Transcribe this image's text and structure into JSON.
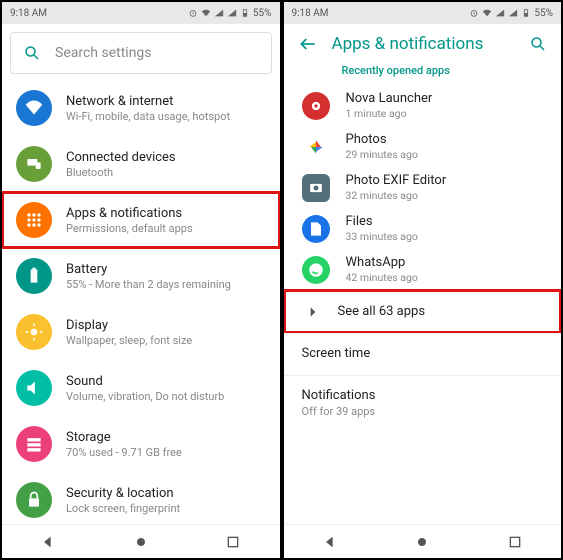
{
  "status": {
    "time": "9:18 AM",
    "battery": "55%"
  },
  "left": {
    "search_placeholder": "Search settings",
    "items": [
      {
        "title": "Network & internet",
        "sub": "Wi-Fi, mobile, data usage, hotspot"
      },
      {
        "title": "Connected devices",
        "sub": "Bluetooth"
      },
      {
        "title": "Apps & notifications",
        "sub": "Permissions, default apps"
      },
      {
        "title": "Battery",
        "sub": "55% - More than 2 days remaining"
      },
      {
        "title": "Display",
        "sub": "Wallpaper, sleep, font size"
      },
      {
        "title": "Sound",
        "sub": "Volume, vibration, Do not disturb"
      },
      {
        "title": "Storage",
        "sub": "70% used - 9.71 GB free"
      },
      {
        "title": "Security & location",
        "sub": "Lock screen, fingerprint"
      }
    ]
  },
  "right": {
    "header": "Apps & notifications",
    "subheader": "Recently opened apps",
    "apps": [
      {
        "title": "Nova Launcher",
        "sub": "1 minute ago"
      },
      {
        "title": "Photos",
        "sub": "29 minutes ago"
      },
      {
        "title": "Photo EXIF Editor",
        "sub": "32 minutes ago"
      },
      {
        "title": "Files",
        "sub": "33 minutes ago"
      },
      {
        "title": "WhatsApp",
        "sub": "42 minutes ago"
      }
    ],
    "see_all": "See all 63 apps",
    "screen_time": "Screen time",
    "notifications_title": "Notifications",
    "notifications_sub": "Off for 39 apps"
  }
}
